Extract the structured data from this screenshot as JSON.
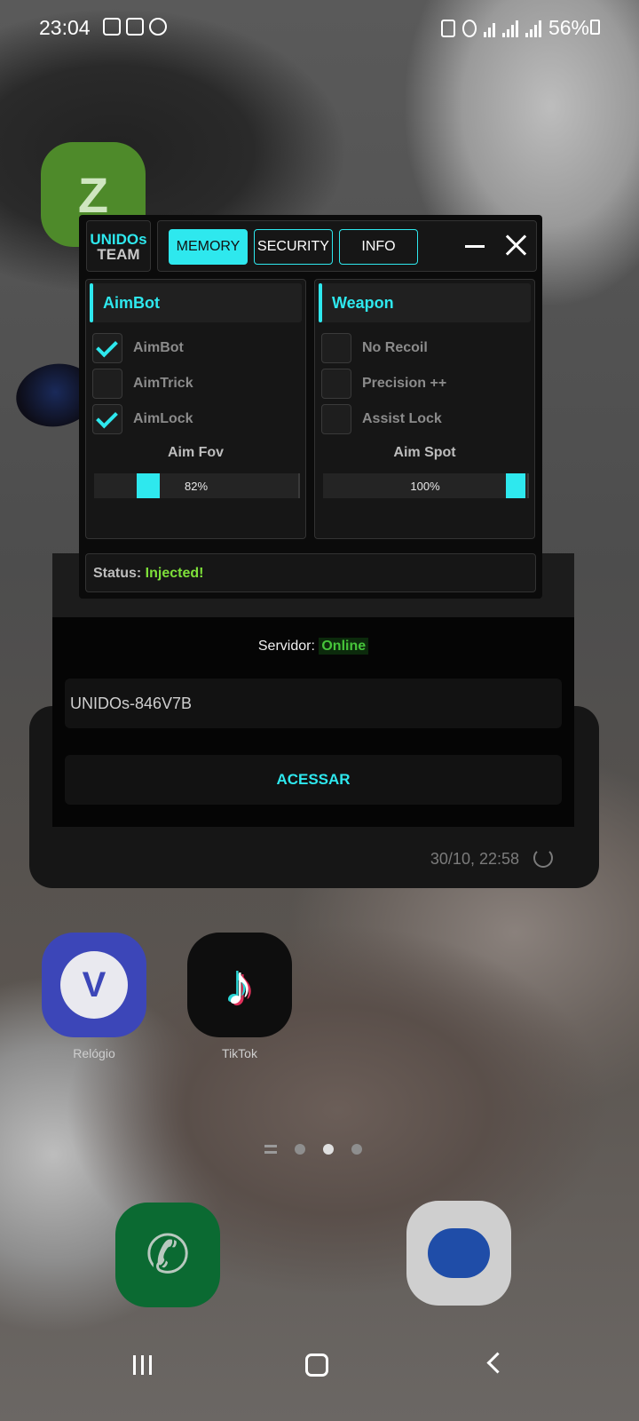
{
  "status_bar": {
    "time": "23:04",
    "battery": "56%",
    "left_icons": [
      "gallery-icon",
      "youtube-icon",
      "whatsapp-icon"
    ],
    "right_icons": [
      "sim-icon",
      "mute-icon",
      "wifi-icon",
      "signal-icon",
      "signal-icon",
      "battery-charging-icon"
    ]
  },
  "home": {
    "apps": [
      {
        "label": "ZA",
        "icon": "zarchiver-icon"
      },
      {
        "label": "Relógio",
        "icon": "clock-icon"
      },
      {
        "label": "TikTok",
        "icon": "tiktok-icon"
      }
    ],
    "dock": [
      {
        "icon": "phone-icon"
      },
      {
        "icon": "messages-icon"
      }
    ],
    "page_indicator": {
      "pages": 3,
      "current": 2
    }
  },
  "widget": {
    "timestamp": "30/10, 22:58"
  },
  "login": {
    "server_label": "Servidor: ",
    "server_status": "Online",
    "key_value": "UNIDOs-846V7B",
    "access_button": "ACESSAR"
  },
  "mod_menu": {
    "logo_line1": "UNIDOs",
    "logo_line2": "TEAM",
    "tabs": [
      {
        "label": "MEMORY",
        "active": true
      },
      {
        "label": "SECURITY",
        "active": false
      },
      {
        "label": "INFO",
        "active": false
      }
    ],
    "aimbot_panel": {
      "title": "AimBot",
      "options": [
        {
          "label": "AimBot",
          "checked": true
        },
        {
          "label": "AimTrick",
          "checked": false
        },
        {
          "label": "AimLock",
          "checked": true
        }
      ],
      "slider_title": "Aim Fov",
      "slider_value": 0.82,
      "slider_text": "82%"
    },
    "weapon_panel": {
      "title": "Weapon",
      "options": [
        {
          "label": "No Recoil",
          "checked": false
        },
        {
          "label": "Precision ++",
          "checked": false
        },
        {
          "label": "Assist Lock",
          "checked": false
        }
      ],
      "slider_title": "Aim Spot",
      "slider_value": 1.0,
      "slider_text": "100%"
    },
    "status_label": "Status: ",
    "status_value": "Injected!"
  },
  "colors": {
    "accent": "#2ee8ee",
    "online": "#46c53a",
    "injected": "#7ee03a"
  }
}
